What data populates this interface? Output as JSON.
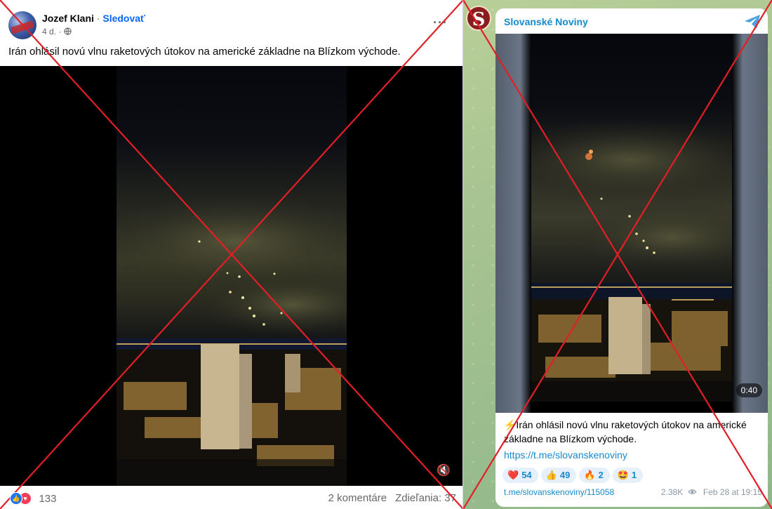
{
  "facebook": {
    "author": "Jozef Klani",
    "separator": "·",
    "follow_label": "Sledovať",
    "timestamp": "4 d. ·",
    "more_label": "···",
    "post_text": "Irán ohlásil novú vlnu raketových útokov na americké základne na Blízkom východe.",
    "reaction_count": "133",
    "comments": "2 komentáre",
    "shares": "Zdieľania: 37",
    "mute_icon": "🔇"
  },
  "telegram": {
    "channel_name": "Slovanské Noviny",
    "avatar_letter": "S",
    "video_duration": "0:40",
    "post_text": "⚡Irán ohlásil novú vlnu raketových útokov na americké základne na Blízkom východe.",
    "link": "https://t.me/slovanskenoviny",
    "reactions": [
      {
        "emoji": "❤️",
        "count": "54"
      },
      {
        "emoji": "👍",
        "count": "49"
      },
      {
        "emoji": "🔥",
        "count": "2"
      },
      {
        "emoji": "🤩",
        "count": "1"
      }
    ],
    "post_link": "t.me/slovanskenoviny/115058",
    "views": "2.38K",
    "date": "Feb 28 at 19:15"
  },
  "colors": {
    "fb_blue": "#0866ff",
    "tg_blue": "#168acd",
    "cross_red": "#e21f26"
  }
}
